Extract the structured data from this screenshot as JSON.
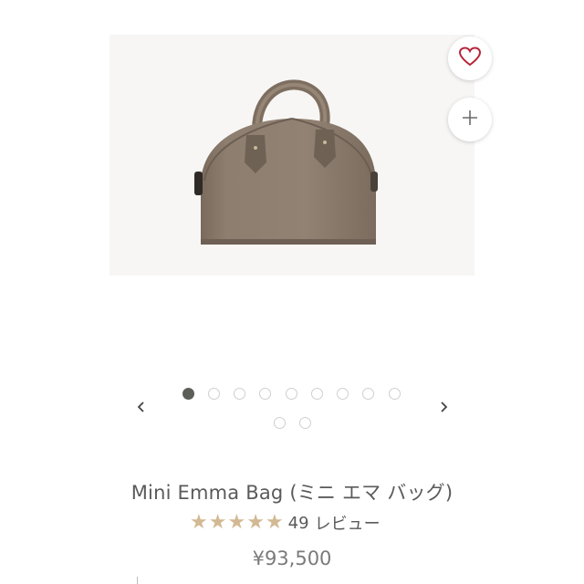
{
  "product": {
    "title": "Mini Emma Bag (ミニ エマ バッグ)",
    "rating_value": 5,
    "review_count": "49",
    "review_label": "レビュー",
    "price": "¥93,500"
  },
  "gallery": {
    "total_images": 11,
    "active_index": 0,
    "image_subject": "taupe leather dome handbag"
  },
  "icons": {
    "favorite": "heart-icon",
    "add": "plus-icon",
    "prev": "chevron-left-icon",
    "next": "chevron-right-icon",
    "star": "star-icon"
  },
  "colors": {
    "heart": "#b5253a",
    "star": "#d2b993",
    "active_dot": "#5c5e58",
    "bag": "#8b7b6c"
  }
}
